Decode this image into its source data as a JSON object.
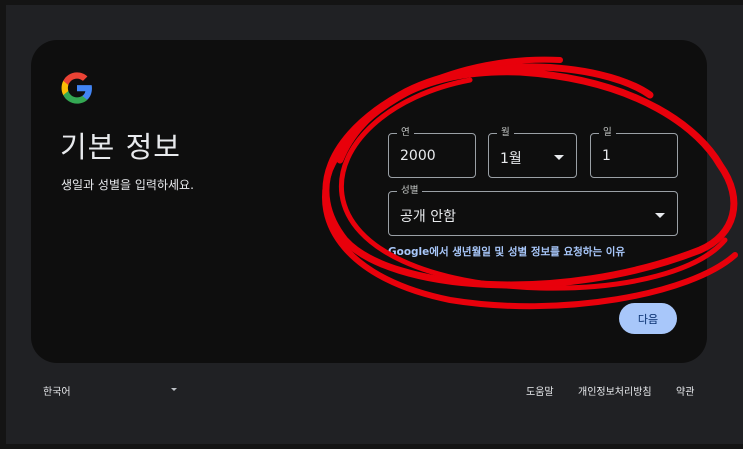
{
  "page": {
    "title": "기본 정보",
    "subtitle": "생일과 성별을 입력하세요."
  },
  "form": {
    "year": {
      "label": "연",
      "value": "2000"
    },
    "month": {
      "label": "월",
      "value": "1월"
    },
    "day": {
      "label": "일",
      "value": "1"
    },
    "gender": {
      "label": "성별",
      "value": "공개 안함"
    },
    "info_link": "Google에서 생년월일 및 성별 정보를 요청하는 이유",
    "next_label": "다음"
  },
  "footer": {
    "language": "한국어",
    "help": "도움말",
    "privacy": "개인정보처리방침",
    "terms": "약관"
  },
  "colors": {
    "background": "#202124",
    "card": "#0e0e0e",
    "accent": "#a8c7fa",
    "annotation": "#e8000b"
  },
  "icons": [
    "google-logo-icon",
    "month-dropdown-icon",
    "gender-dropdown-icon",
    "language-dropdown-icon"
  ]
}
